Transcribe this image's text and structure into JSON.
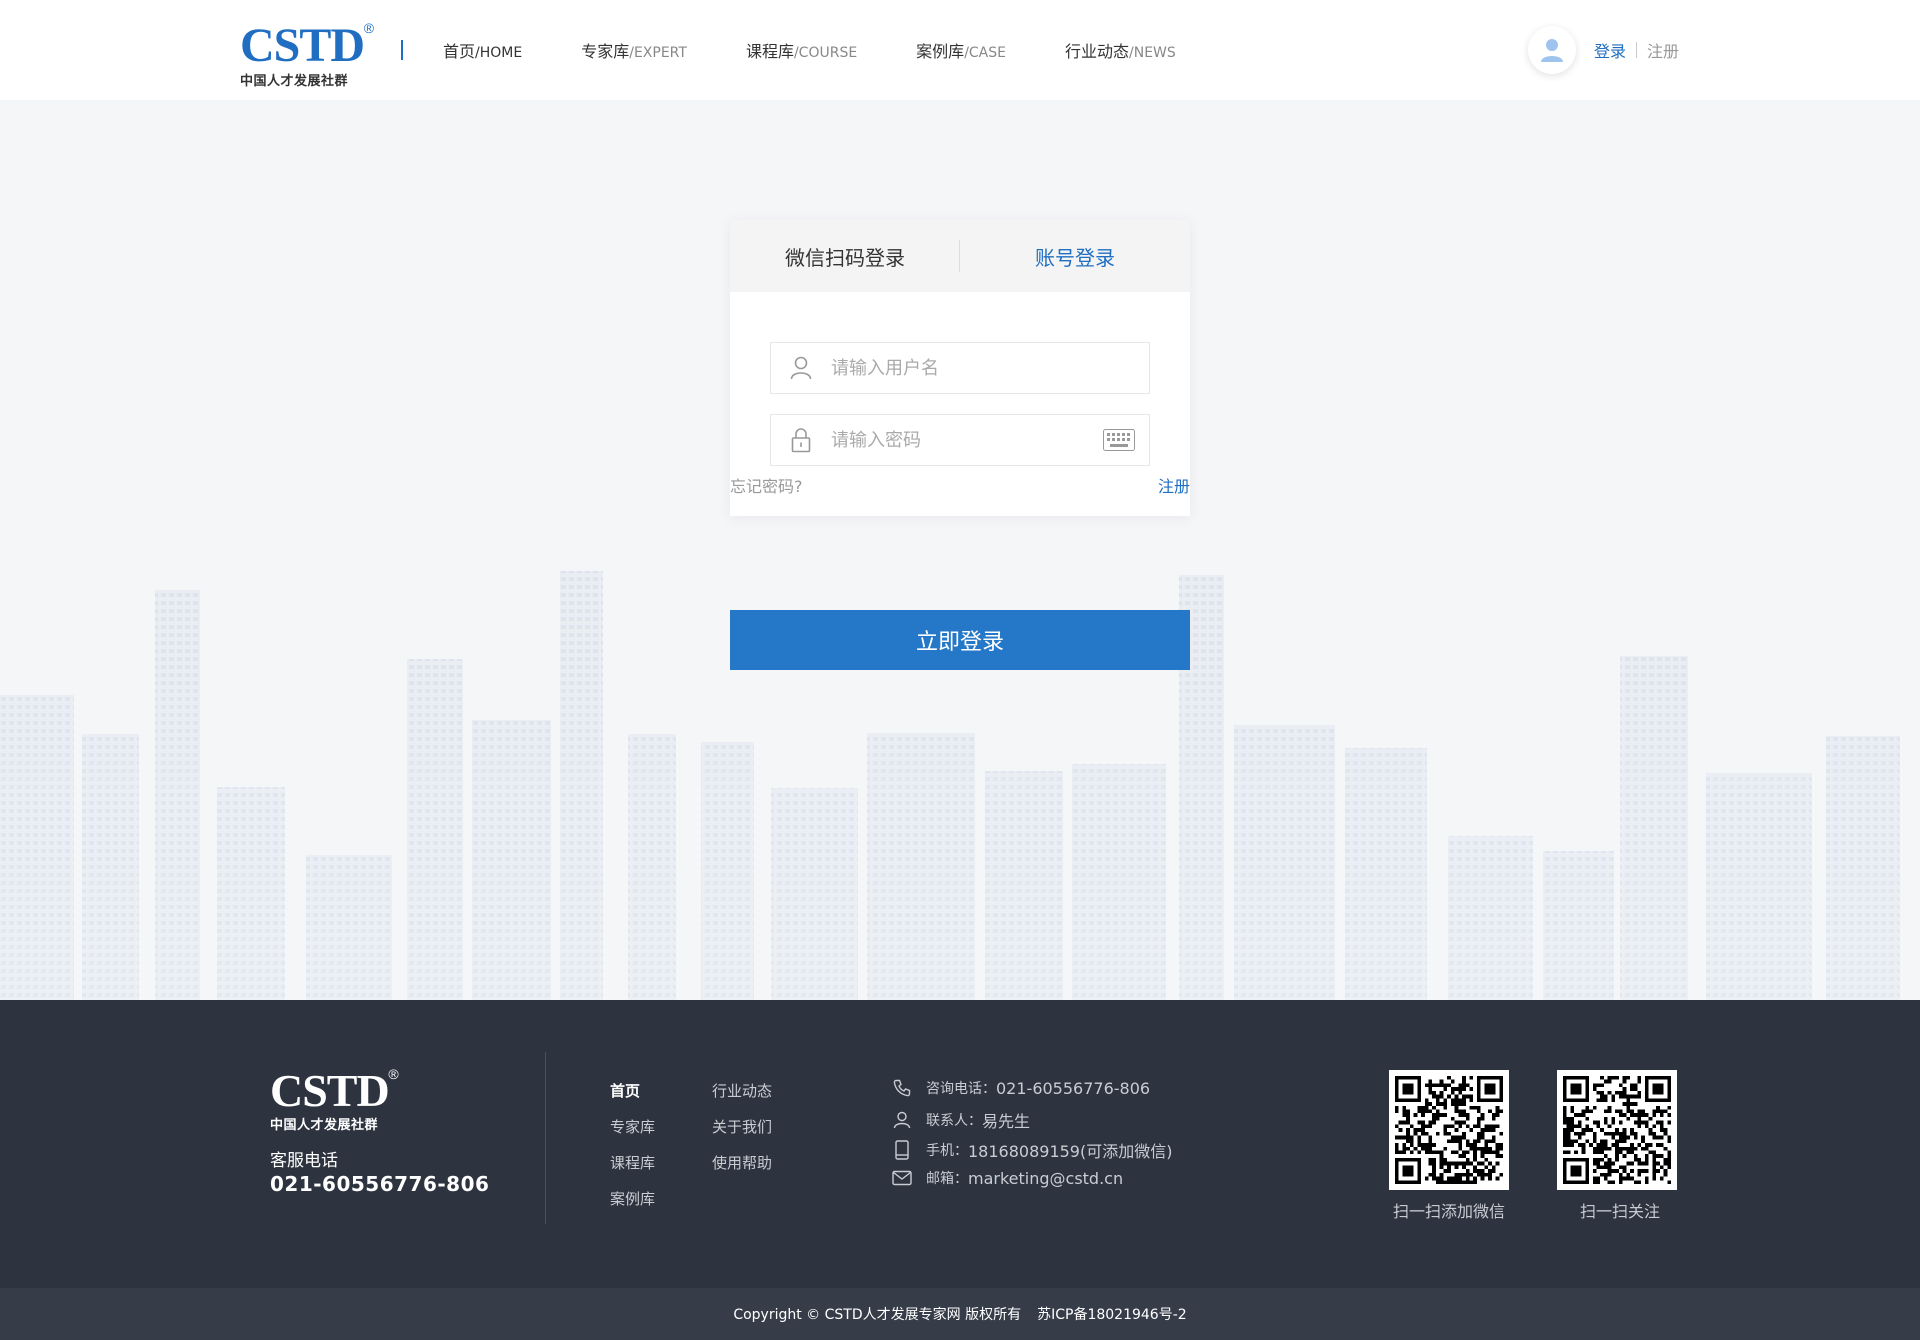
{
  "header": {
    "logo_text": "CSTD",
    "logo_reg": "®",
    "logo_sub": "中国人才发展社群",
    "nav": [
      {
        "cn": "首页",
        "en": "/HOME"
      },
      {
        "cn": "专家库",
        "en": "/EXPERT"
      },
      {
        "cn": "课程库",
        "en": "/COURSE"
      },
      {
        "cn": "案例库",
        "en": "/CASE"
      },
      {
        "cn": "行业动态",
        "en": "/NEWS"
      }
    ],
    "login": "登录",
    "register": "注册"
  },
  "login": {
    "tab_wechat": "微信扫码登录",
    "tab_account": "账号登录",
    "username_placeholder": "请输入用户名",
    "password_placeholder": "请输入密码",
    "forgot": "忘记密码?",
    "register": "注册",
    "submit": "立即登录"
  },
  "footer": {
    "logo_text": "CSTD",
    "logo_reg": "®",
    "logo_sub": "中国人才发展社群",
    "service_label": "客服电话",
    "service_phone": "021-60556776-806",
    "nav_col1": [
      "首页",
      "专家库",
      "课程库",
      "案例库"
    ],
    "nav_col2": [
      "行业动态",
      "关于我们",
      "使用帮助"
    ],
    "contacts": [
      {
        "label": "咨询电话：",
        "value": "021-60556776-806",
        "icon": "phone-icon"
      },
      {
        "label": "联系人：",
        "value": "易先生",
        "icon": "person-icon"
      },
      {
        "label": "手机：",
        "value": "18168089159(可添加微信)",
        "icon": "mobile-icon"
      },
      {
        "label": "邮箱：",
        "value": "marketing@cstd.cn",
        "icon": "mail-icon"
      }
    ],
    "qr_wechat_caption": "扫一扫添加微信",
    "qr_follow_caption": "扫一扫关注",
    "copyright": "Copyright © CSTD人才发展专家网 版权所有",
    "icp": "苏ICP备18021946号-2"
  },
  "colors": {
    "brand_blue": "#1f6ec2",
    "button_blue": "#2578c8",
    "footer_bg": "#2d3440"
  }
}
